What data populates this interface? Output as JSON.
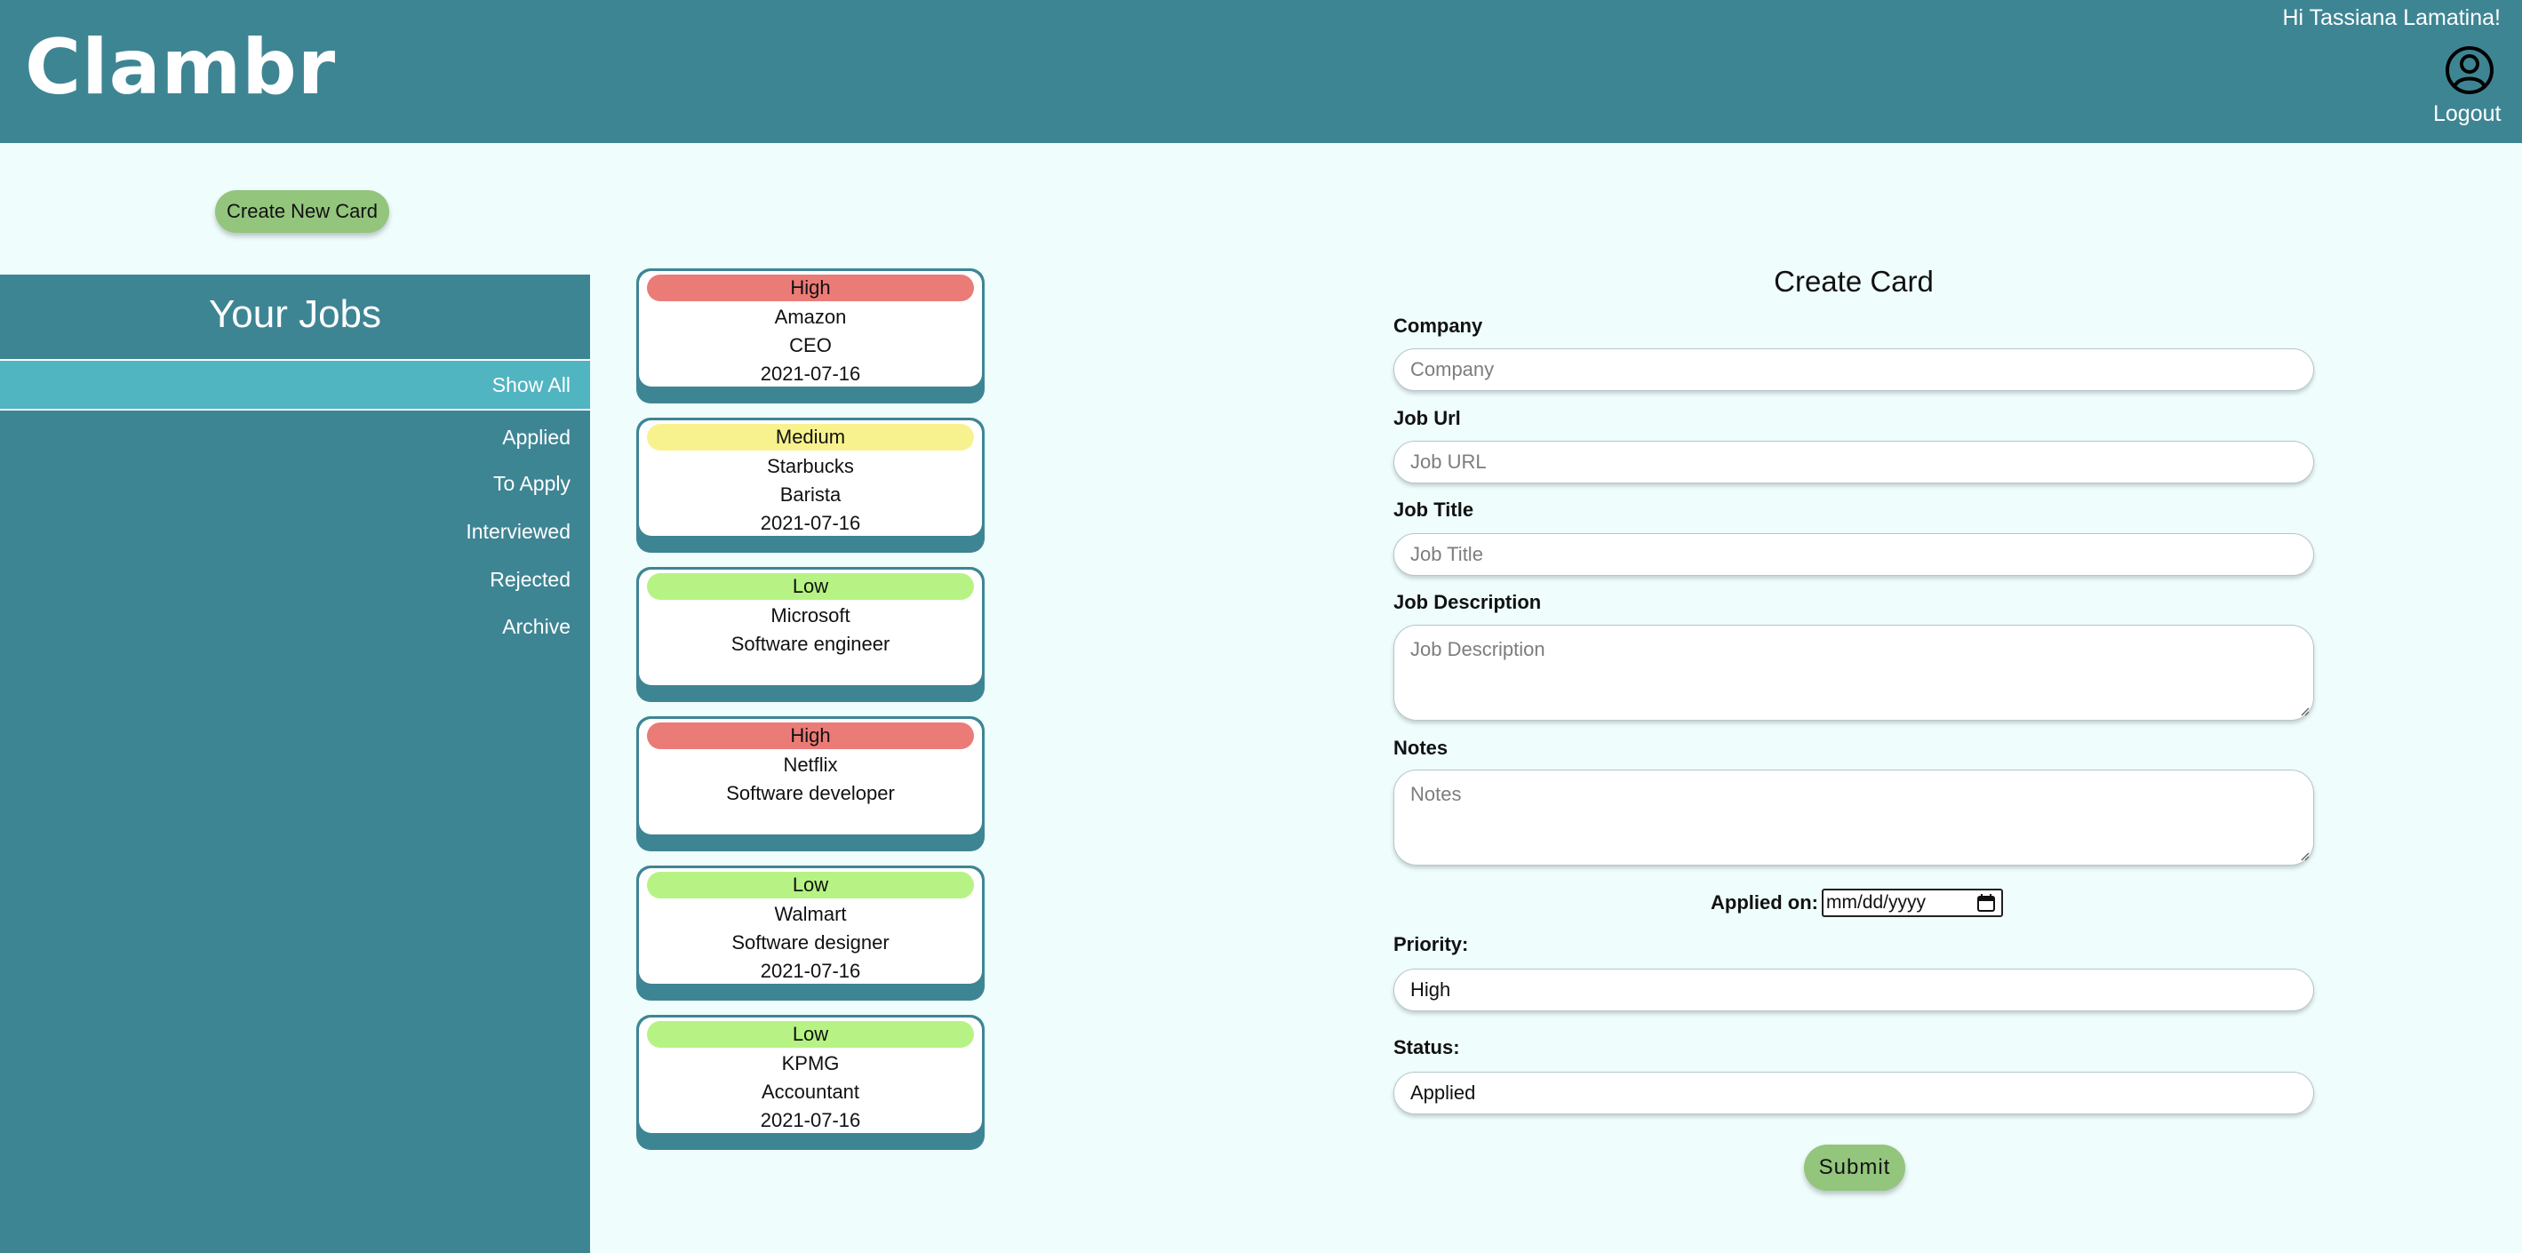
{
  "header": {
    "logo": "Clambr",
    "greeting": "Hi Tassiana Lamatina!",
    "logout_label": "Logout"
  },
  "toolbar": {
    "create_new_card_label": "Create New Card"
  },
  "sidebar": {
    "title": "Your Jobs",
    "items": [
      {
        "label": "Show All",
        "active": true
      },
      {
        "label": "Applied"
      },
      {
        "label": "To Apply"
      },
      {
        "label": "Interviewed"
      },
      {
        "label": "Rejected"
      },
      {
        "label": "Archive"
      }
    ]
  },
  "priority_colors": {
    "High": "#eb7b76",
    "Medium": "#f7f28e",
    "Low": "#b6f384"
  },
  "cards": [
    {
      "priority": "High",
      "company": "Amazon",
      "title": "CEO",
      "date": "2021-07-16"
    },
    {
      "priority": "Medium",
      "company": "Starbucks",
      "title": "Barista",
      "date": "2021-07-16"
    },
    {
      "priority": "Low",
      "company": "Microsoft",
      "title": "Software engineer",
      "date": ""
    },
    {
      "priority": "High",
      "company": "Netflix",
      "title": "Software developer",
      "date": ""
    },
    {
      "priority": "Low",
      "company": "Walmart",
      "title": "Software designer",
      "date": "2021-07-16"
    },
    {
      "priority": "Low",
      "company": "KPMG",
      "title": "Accountant",
      "date": "2021-07-16"
    }
  ],
  "form": {
    "title": "Create Card",
    "company_label": "Company",
    "company_placeholder": "Company",
    "job_url_label": "Job Url",
    "job_url_placeholder": "Job URL",
    "job_title_label": "Job Title",
    "job_title_placeholder": "Job Title",
    "job_description_label": "Job Description",
    "job_description_placeholder": "Job Description",
    "notes_label": "Notes",
    "notes_placeholder": "Notes",
    "applied_on_label": "Applied on:",
    "applied_on_placeholder": "mm/dd/yyyy",
    "priority_label": "Priority:",
    "priority_value": "High",
    "status_label": "Status:",
    "status_value": "Applied",
    "submit_label": "Submit"
  },
  "colors": {
    "header_bg": "#3e8594",
    "sidebar_active_bg": "#51b4c1",
    "page_bg": "#effdfd",
    "button_green": "#93c57d"
  }
}
